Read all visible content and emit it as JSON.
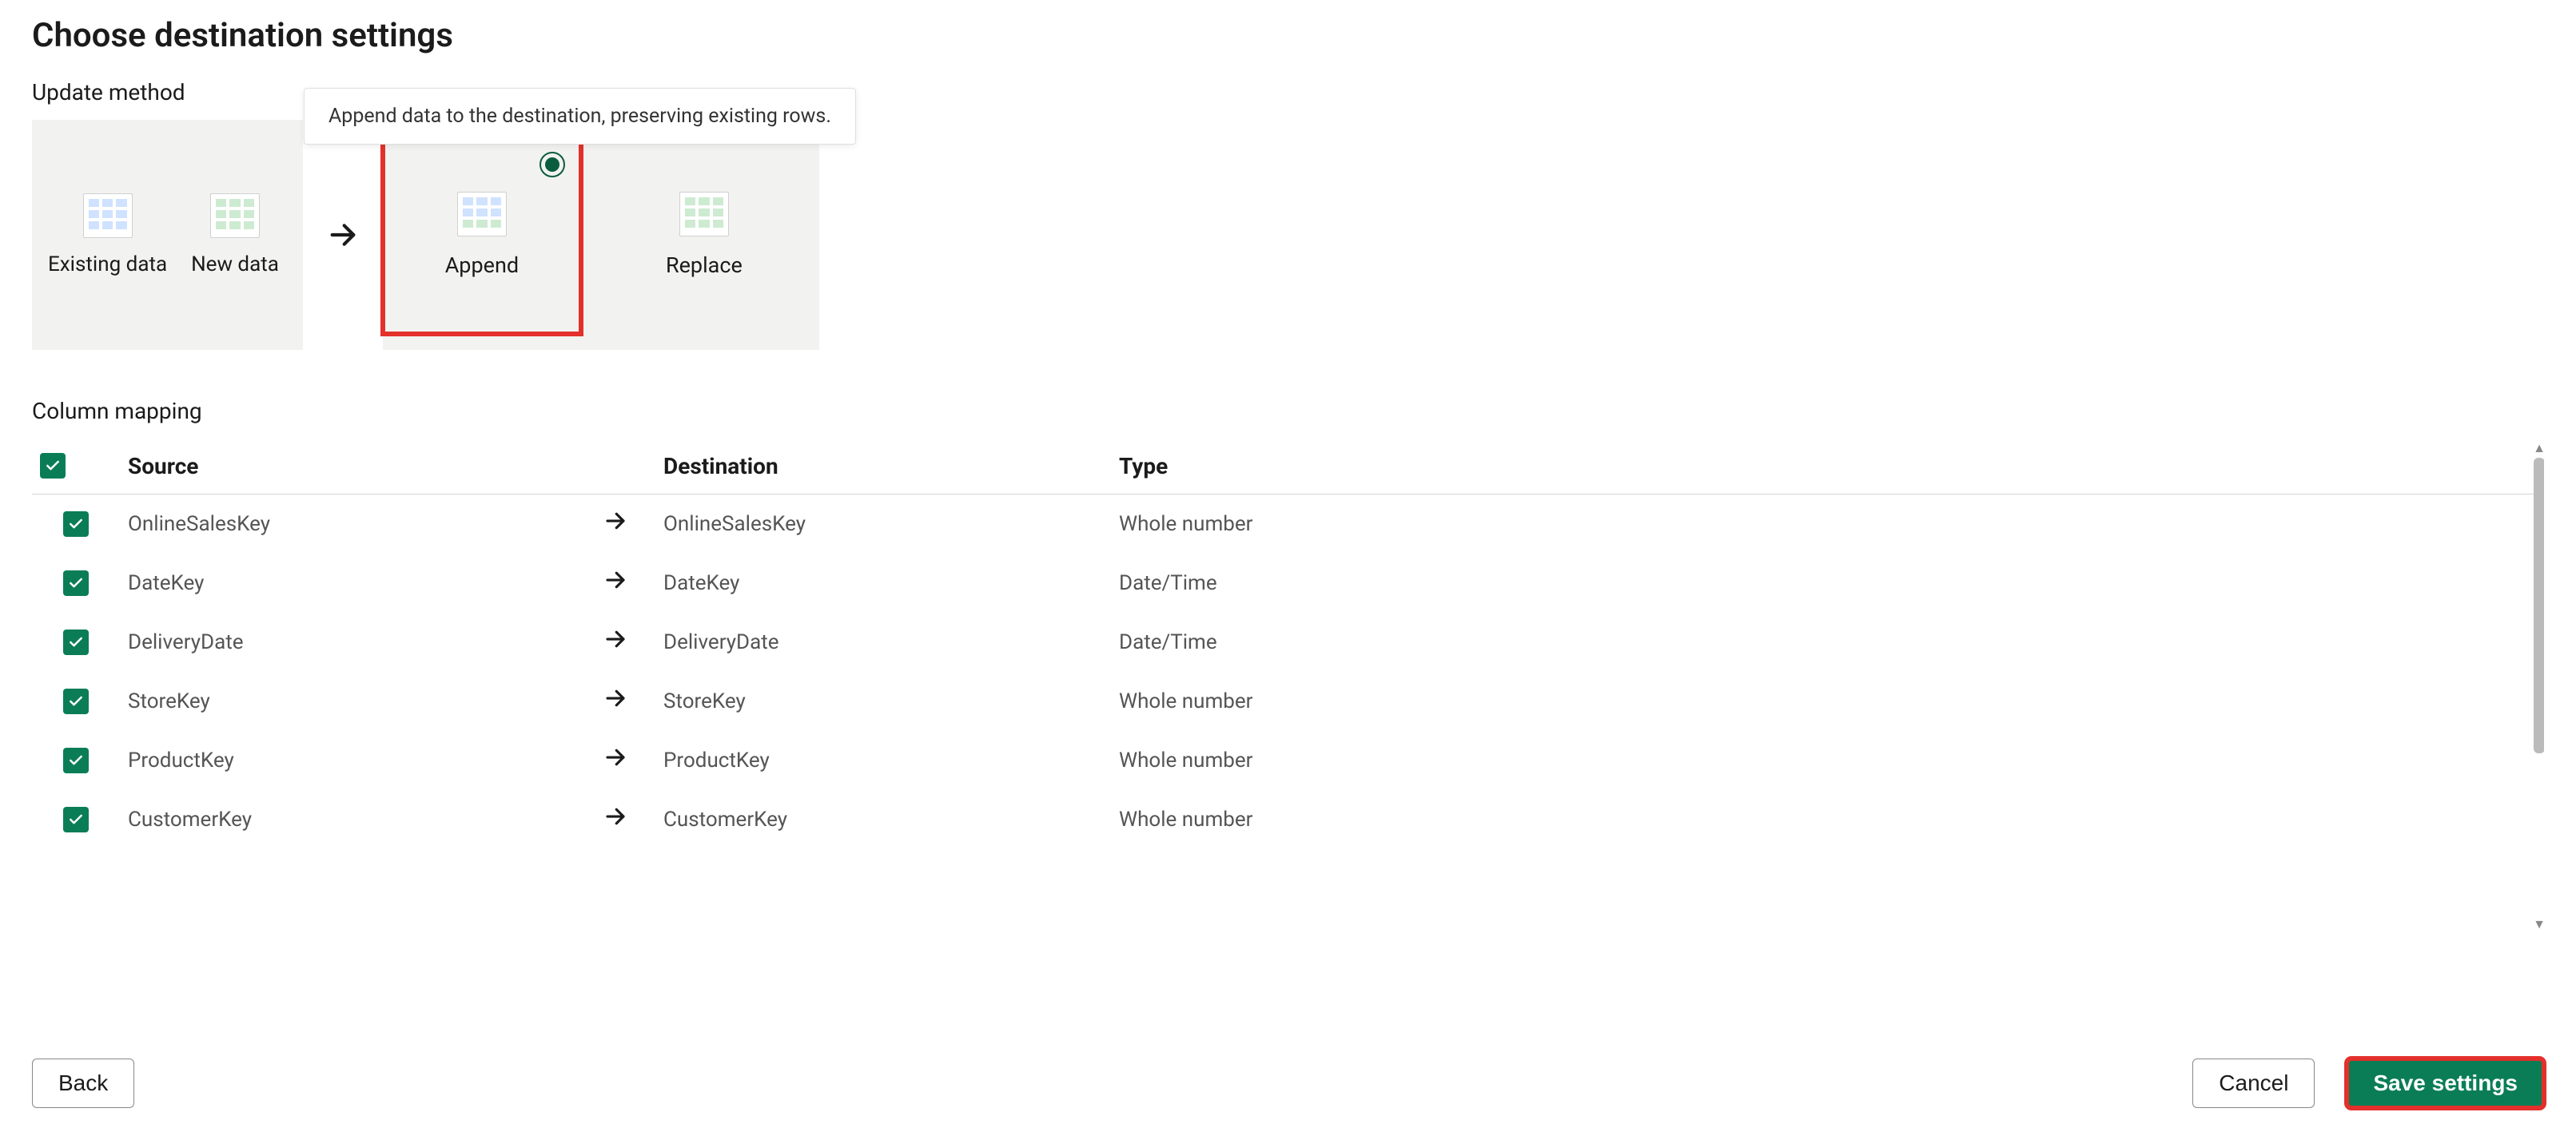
{
  "title": "Choose destination settings",
  "update_method": {
    "label": "Update method",
    "tooltip": "Append data to the destination, preserving existing rows.",
    "existing_label": "Existing data",
    "new_label": "New data",
    "append_label": "Append",
    "replace_label": "Replace",
    "selected": "append"
  },
  "mapping": {
    "label": "Column mapping",
    "headers": {
      "source": "Source",
      "destination": "Destination",
      "type": "Type"
    },
    "rows": [
      {
        "checked": true,
        "source": "OnlineSalesKey",
        "destination": "OnlineSalesKey",
        "type": "Whole number"
      },
      {
        "checked": true,
        "source": "DateKey",
        "destination": "DateKey",
        "type": "Date/Time"
      },
      {
        "checked": true,
        "source": "DeliveryDate",
        "destination": "DeliveryDate",
        "type": "Date/Time"
      },
      {
        "checked": true,
        "source": "StoreKey",
        "destination": "StoreKey",
        "type": "Whole number"
      },
      {
        "checked": true,
        "source": "ProductKey",
        "destination": "ProductKey",
        "type": "Whole number"
      },
      {
        "checked": true,
        "source": "CustomerKey",
        "destination": "CustomerKey",
        "type": "Whole number"
      }
    ]
  },
  "footer": {
    "back": "Back",
    "cancel": "Cancel",
    "save": "Save settings"
  }
}
